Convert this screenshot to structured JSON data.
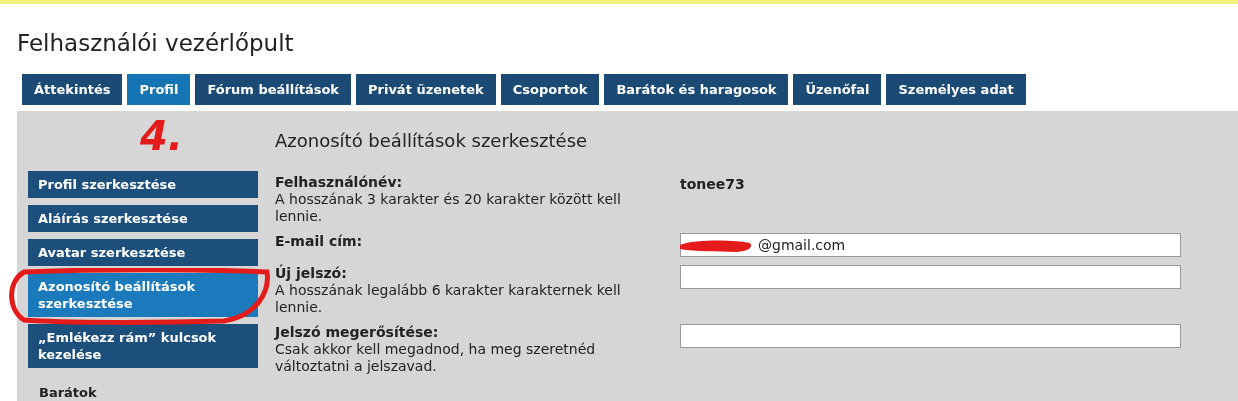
{
  "page_title": "Felhasználói vezérlőpult",
  "tabs": [
    {
      "label": "Áttekintés",
      "selected": false
    },
    {
      "label": "Profil",
      "selected": true
    },
    {
      "label": "Fórum beállítások",
      "selected": false
    },
    {
      "label": "Privát üzenetek",
      "selected": false
    },
    {
      "label": "Csoportok",
      "selected": false
    },
    {
      "label": "Barátok és haragosok",
      "selected": false
    },
    {
      "label": "Üzenőfal",
      "selected": false
    },
    {
      "label": "Személyes adat",
      "selected": false
    }
  ],
  "sidebar": {
    "items": [
      {
        "label": "Profil szerkesztése",
        "selected": false
      },
      {
        "label": "Aláírás szerkesztése",
        "selected": false
      },
      {
        "label": "Avatar szerkesztése",
        "selected": false
      },
      {
        "label": "Azonosító beállítások szerkesztése",
        "selected": true
      },
      {
        "label": "„Emlékezz rám” kulcsok kezelése",
        "selected": false
      }
    ],
    "section_heading": "Barátok"
  },
  "content": {
    "heading": "Azonosító beállítások szerkesztése",
    "rows": [
      {
        "kind": "text",
        "label": "Felhasználónév:",
        "hint": "A hosszának 3 karakter és 20 karakter között kell lennie.",
        "value": "tonee73"
      },
      {
        "kind": "input",
        "label": "E-mail cím:",
        "value": "@gmail.com",
        "redacted": true
      },
      {
        "kind": "input",
        "label": "Új jelszó:",
        "hint": "A hosszának legalább 6 karakter karakternek kell lennie."
      },
      {
        "kind": "input",
        "label": "Jelszó megerősítése:",
        "hint": "Csak akkor kell megadnod, ha meg szeretnéd változtatni a jelszavad."
      }
    ]
  },
  "annotation": {
    "label": "4.",
    "circled": true
  }
}
